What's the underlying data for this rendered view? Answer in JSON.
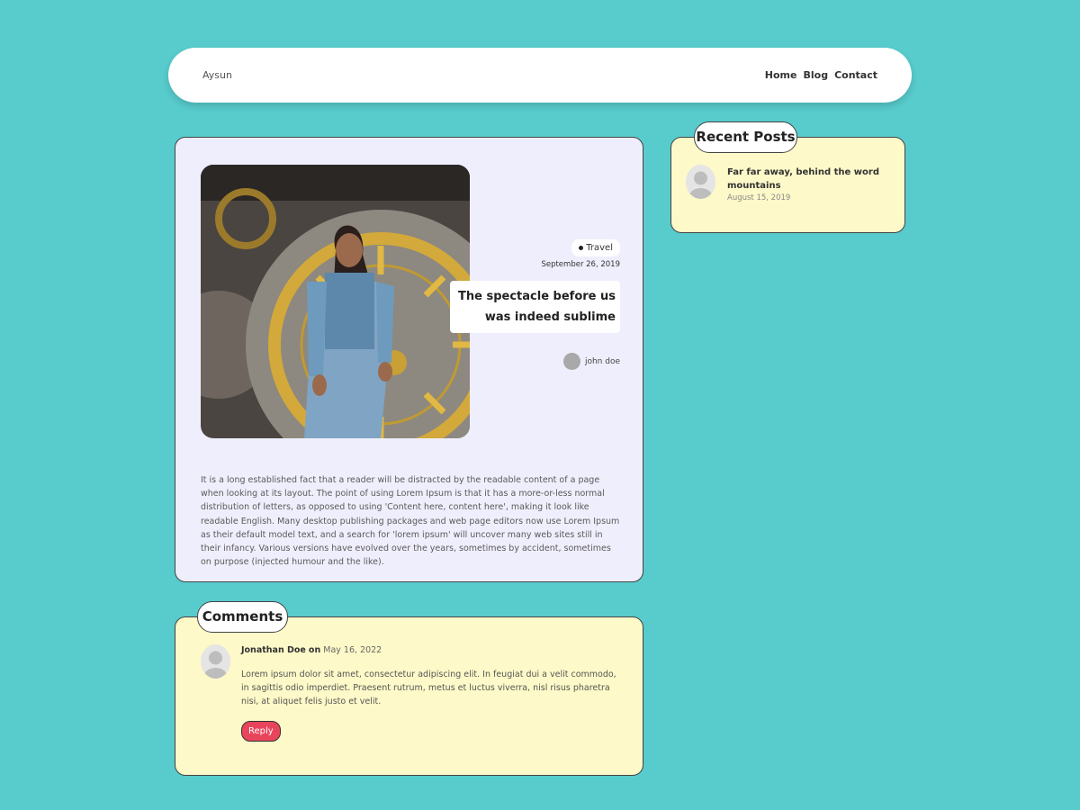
{
  "nav": {
    "brand": "Aysun",
    "links": [
      "Home",
      "Blog",
      "Contact"
    ]
  },
  "post": {
    "tag": "Travel",
    "date": "September 26, 2019",
    "title_line1": "The spectacle before us",
    "title_line2": "was indeed sublime",
    "author": "john doe",
    "body": "It is a long established fact that a reader will be distracted by the readable content of a page when looking at its layout. The point of using Lorem Ipsum is that it has a more-or-less normal distribution of letters, as opposed to using 'Content here, content here', making it look like readable English. Many desktop publishing packages and web page editors now use Lorem Ipsum as their default model text, and a search for 'lorem ipsum' will uncover many web sites still in their infancy. Various versions have evolved over the years, sometimes by accident, sometimes on purpose (injected humour and the like)."
  },
  "comments": {
    "heading": "Comments",
    "items": [
      {
        "author": "Jonathan Doe",
        "on": "on",
        "date": "May 16, 2022",
        "text": "Lorem ipsum dolor sit amet, consectetur adipiscing elit. In feugiat dui a velit commodo, in sagittis odio imperdiet. Praesent rutrum, metus et luctus viverra, nisl risus pharetra nisi, at aliquet felis justo et velit.",
        "reply_label": "Reply"
      }
    ]
  },
  "recent": {
    "heading": "Recent Posts",
    "items": [
      {
        "title": "Far far away, behind the word mountains",
        "date": "August 15, 2019"
      }
    ]
  },
  "colors": {
    "background": "#58cbcd",
    "post_card": "#efeefc",
    "side_card": "#fdf9c8",
    "reply_button": "#e8455c"
  }
}
